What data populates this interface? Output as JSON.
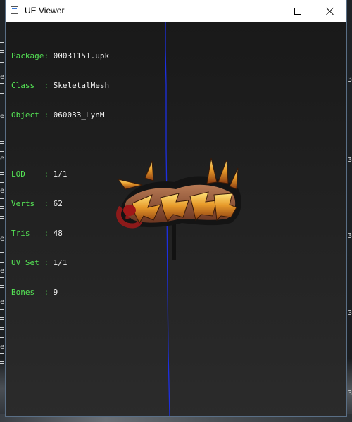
{
  "window": {
    "title": "UE Viewer"
  },
  "info": {
    "package": {
      "label": "Package",
      "value": "00031151.upk"
    },
    "class": {
      "label": "Class  ",
      "value": "SkeletalMesh"
    },
    "object": {
      "label": "Object ",
      "value": "060033_LynM"
    },
    "lod": {
      "label": "LOD    ",
      "value": "1/1"
    },
    "verts": {
      "label": "Verts  ",
      "value": "62"
    },
    "tris": {
      "label": "Tris   ",
      "value": "48"
    },
    "uvset": {
      "label": "UV Set ",
      "value": "1/1"
    },
    "bones": {
      "label": "Bones  ",
      "value": "9"
    }
  },
  "colors": {
    "label_green": "#55e455",
    "value_white": "#f2f2f2",
    "axis_blue": "#1d2fe0"
  },
  "background": {
    "left_letters": [
      "e",
      "e",
      "e",
      "e",
      "e",
      "e",
      "e",
      "e",
      "e"
    ],
    "right_numbers": [
      "3",
      "3",
      "3",
      "3",
      "3",
      "3",
      "3"
    ]
  }
}
